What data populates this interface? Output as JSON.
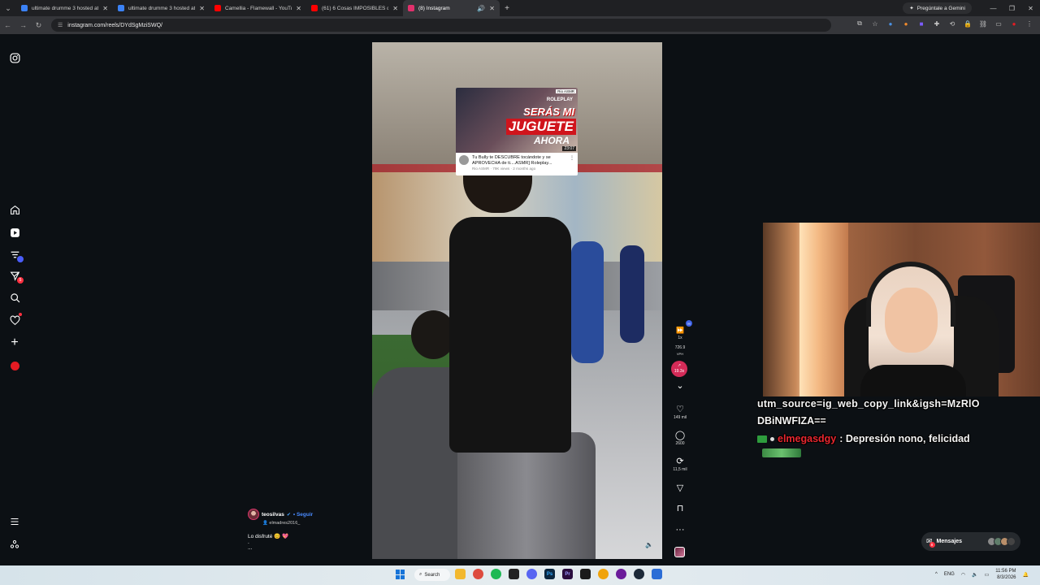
{
  "browser": {
    "tabs": [
      {
        "title": "ultimate drumme 3 hosted at Im",
        "color": "#3b82f6"
      },
      {
        "title": "ultimate drumme 3 hosted at Im",
        "color": "#3b82f6"
      },
      {
        "title": "Camellia - Flamewall - YouTube",
        "color": "#ff0000"
      },
      {
        "title": "(61) 6 Cosas IMPOSIBLES de G",
        "color": "#ff0000"
      },
      {
        "title": "(8) Instagram",
        "color": "#e1306c"
      }
    ],
    "gemini_label": "Pregúntale a Gemini",
    "url": "instagram.com/reels/DYdSgMziSWQ/"
  },
  "reel": {
    "yt_card": {
      "tag": "ROLEPLAY",
      "asmr_tag": "Rio ASMR",
      "line1": "SERÁS MI",
      "line2": "JUGUETE",
      "line3": "AHORA",
      "duration": "23:07",
      "title": "Tu Bully te DESCUBRE tocándote y se APROVECHA de ti....ASMR] Roleplay...",
      "meta": "Rio ASMR · 79K views · 2 months ago"
    },
    "controls": {
      "speed": "1x",
      "speed_badge": "H",
      "views": "726.9",
      "views_unit": "VPH",
      "boost": "19.3x",
      "likes": "149 mil",
      "comments": "2600",
      "reposts": "11,5 mil"
    },
    "caption": {
      "username": "teosilvas",
      "follow": "• Seguir",
      "collab": "elmadres2016_",
      "text": "Lo disfruté 😊 💖",
      "dot": ".",
      "more": "..."
    }
  },
  "nav": {
    "notif_badge": "1",
    "messages_badge": "5",
    "messages_label": "Mensajes",
    "messages_count": "8"
  },
  "chat": {
    "line1": "utm_source=ig_web_copy_link&igsh=MzRlO",
    "line2": "DBiNWFIZA==",
    "username": "elmegasdgy",
    "message": ": Depresión nono, felicidad"
  },
  "taskbar": {
    "search": "Search",
    "lang": "ENG",
    "time": "11:56 PM",
    "date": "8/3/2026"
  }
}
